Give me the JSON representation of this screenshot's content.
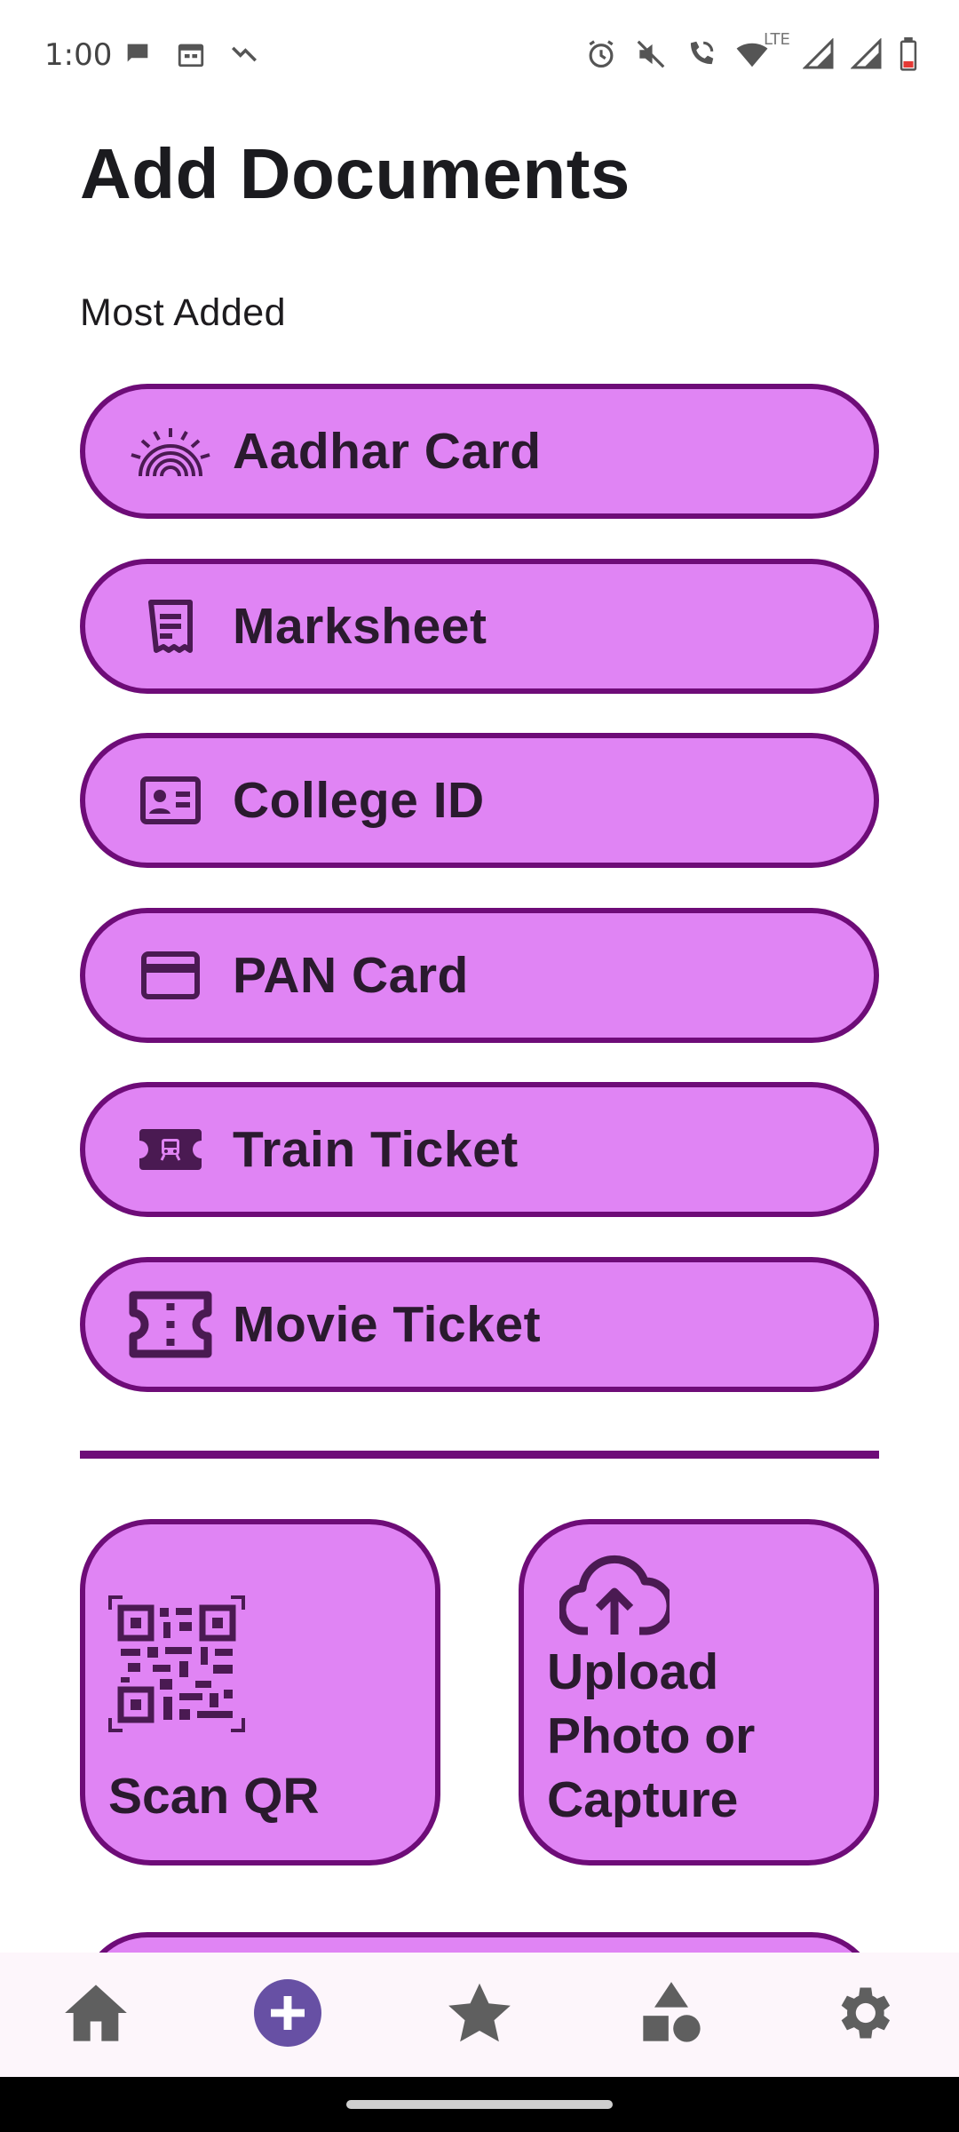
{
  "status_bar": {
    "time": "1:00",
    "lte_label": "LTE",
    "left_icons": [
      "chat-bubble-icon",
      "calendar-icon",
      "missed-call-icon"
    ],
    "right_icons": [
      "alarm-icon",
      "mute-icon",
      "wifi-calling-icon",
      "wifi-icon",
      "signal-icon",
      "signal-icon",
      "battery-icon"
    ]
  },
  "page": {
    "title": "Add Documents",
    "section_label": "Most Added"
  },
  "documents": [
    {
      "label": "Aadhar Card",
      "icon": "fingerprint-icon"
    },
    {
      "label": "Marksheet",
      "icon": "receipt-icon"
    },
    {
      "label": "College ID",
      "icon": "id-card-icon"
    },
    {
      "label": "PAN Card",
      "icon": "credit-card-icon"
    },
    {
      "label": "Train Ticket",
      "icon": "train-ticket-icon"
    },
    {
      "label": "Movie Ticket",
      "icon": "ticket-icon"
    }
  ],
  "actions": {
    "scan_qr": {
      "label": "Scan QR",
      "icon": "qr-code-icon"
    },
    "upload": {
      "label": "Upload Photo or Capture",
      "icon": "cloud-upload-icon"
    }
  },
  "bottom_nav": {
    "items": [
      "home-icon",
      "add-circle-icon",
      "star-icon",
      "category-icon",
      "settings-icon"
    ],
    "active_index": 1
  },
  "colors": {
    "button_fill": "#e084f4",
    "button_border": "#6e0c78",
    "nav_active": "#6750a4",
    "nav_icon": "#5f5f5f"
  }
}
